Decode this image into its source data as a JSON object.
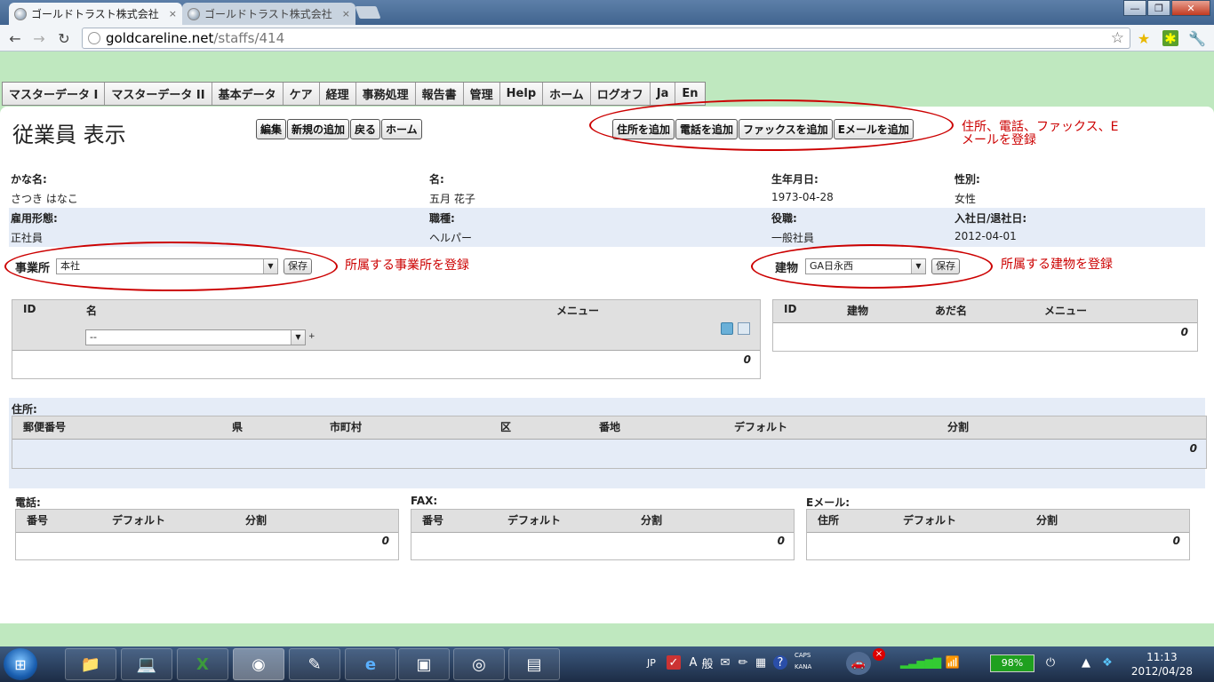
{
  "browser": {
    "tabs": [
      {
        "title": "ゴールドトラスト株式会社",
        "close": "×"
      },
      {
        "title": "ゴールドトラスト株式会社",
        "close": "×"
      }
    ],
    "url_host": "goldcareline.net",
    "url_path": "/staffs/414"
  },
  "nav_menu": [
    "マスターデータ I",
    "マスターデータ II",
    "基本データ",
    "ケア",
    "経理",
    "事務処理",
    "報告書",
    "管理",
    "Help",
    "ホーム",
    "ログオフ",
    "Ja",
    "En"
  ],
  "page_title": "従業員 表示",
  "action_buttons": {
    "edit": "編集",
    "new": "新規の追加",
    "back": "戻る",
    "home": "ホーム"
  },
  "add_buttons": {
    "address": "住所を追加",
    "phone": "電話を追加",
    "fax": "ファックスを追加",
    "email": "Eメールを追加"
  },
  "annotations": {
    "add_contact": "住所、電話、ファックス、E\nメールを登録",
    "office": "所属する事業所を登録",
    "building": "所属する建物を登録"
  },
  "staff": {
    "row1": [
      {
        "label": "かな名:",
        "value": "さつき はなこ"
      },
      {
        "label": "名:",
        "value": "五月 花子"
      },
      {
        "label": "生年月日:",
        "value": "1973-04-28"
      },
      {
        "label": "性別:",
        "value": "女性"
      }
    ],
    "row2": [
      {
        "label": "雇用形態:",
        "value": "正社員"
      },
      {
        "label": "職種:",
        "value": "ヘルパー"
      },
      {
        "label": "役職:",
        "value": "一般社員"
      },
      {
        "label": "入社日/退社日:",
        "value": "2012-04-01"
      }
    ]
  },
  "office_assign": {
    "label": "事業所",
    "selected": "本社",
    "save": "保存",
    "plus": "+"
  },
  "building_assign": {
    "label": "建物",
    "selected": "GA日永西",
    "save": "保存"
  },
  "office_table": {
    "headers": [
      "ID",
      "名",
      "メニュー"
    ],
    "filter_selected": "--",
    "count": "0"
  },
  "building_table": {
    "headers": [
      "ID",
      "建物",
      "あだ名",
      "メニュー"
    ],
    "count": "0"
  },
  "address": {
    "label": "住所:",
    "headers": [
      "郵便番号",
      "県",
      "市町村",
      "区",
      "番地",
      "デフォルト",
      "分割"
    ],
    "count": "0"
  },
  "phone": {
    "label": "電話:",
    "headers": [
      "番号",
      "デフォルト",
      "分割"
    ],
    "count": "0"
  },
  "fax": {
    "label": "FAX:",
    "headers": [
      "番号",
      "デフォルト",
      "分割"
    ],
    "count": "0"
  },
  "email": {
    "label": "Eメール:",
    "headers": [
      "住所",
      "デフォルト",
      "分割"
    ],
    "count": "0"
  },
  "taskbar": {
    "lang": "JP",
    "caps": "CAPS",
    "kana": "KANA",
    "battery": "98%",
    "time": "11:13",
    "date": "2012/04/28",
    "notify_badge": "×"
  },
  "colors": {
    "annotation": "#cc0000",
    "page_bg": "#bfe8bf",
    "band": "#e5ecf7"
  }
}
